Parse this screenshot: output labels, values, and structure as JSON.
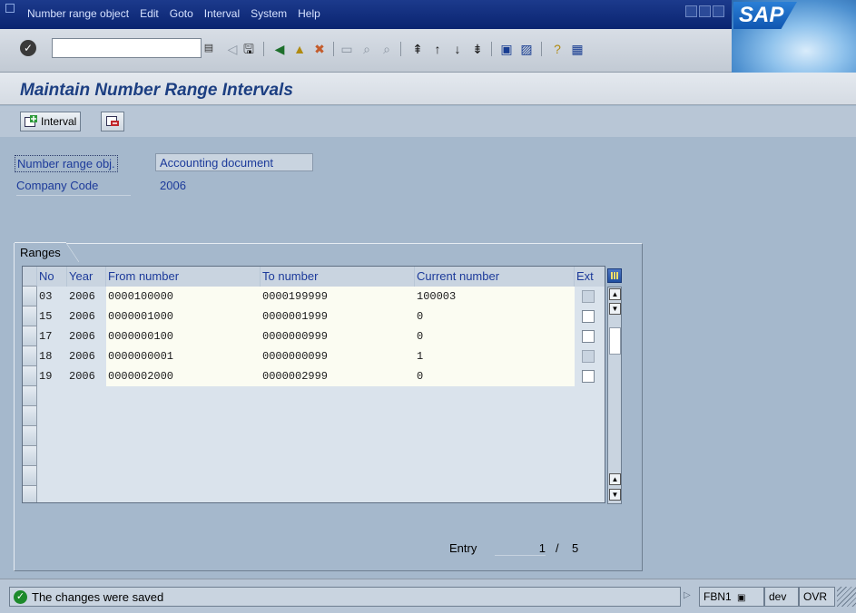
{
  "menu": {
    "items": [
      "Number range object",
      "Edit",
      "Goto",
      "Interval",
      "System",
      "Help"
    ]
  },
  "brand": "SAP",
  "command_field": {
    "value": ""
  },
  "page_title": "Maintain Number Range Intervals",
  "app_toolbar": {
    "interval_label": "Interval"
  },
  "header_fields": {
    "number_range_obj_label": "Number range obj.",
    "number_range_obj_value": "Accounting document",
    "company_code_label": "Company Code",
    "company_code_value": "2006"
  },
  "ranges": {
    "group_title": "Ranges",
    "columns": [
      "No",
      "Year",
      "From number",
      "To number",
      "Current number",
      "Ext"
    ],
    "rows": [
      {
        "no": "03",
        "year": "2006",
        "from": "0000100000",
        "to": "0000199999",
        "current": "100003",
        "ext_enabled": false
      },
      {
        "no": "15",
        "year": "2006",
        "from": "0000001000",
        "to": "0000001999",
        "current": "0",
        "ext_enabled": true
      },
      {
        "no": "17",
        "year": "2006",
        "from": "0000000100",
        "to": "0000000999",
        "current": "0",
        "ext_enabled": true
      },
      {
        "no": "18",
        "year": "2006",
        "from": "0000000001",
        "to": "0000000099",
        "current": "1",
        "ext_enabled": false
      },
      {
        "no": "19",
        "year": "2006",
        "from": "0000002000",
        "to": "0000002999",
        "current": "0",
        "ext_enabled": true
      }
    ]
  },
  "entry": {
    "label": "Entry",
    "current": "1",
    "separator": "/",
    "total": "5"
  },
  "status": {
    "message": "The changes were saved",
    "transaction": "FBN1",
    "system": "dev",
    "mode": "OVR"
  }
}
